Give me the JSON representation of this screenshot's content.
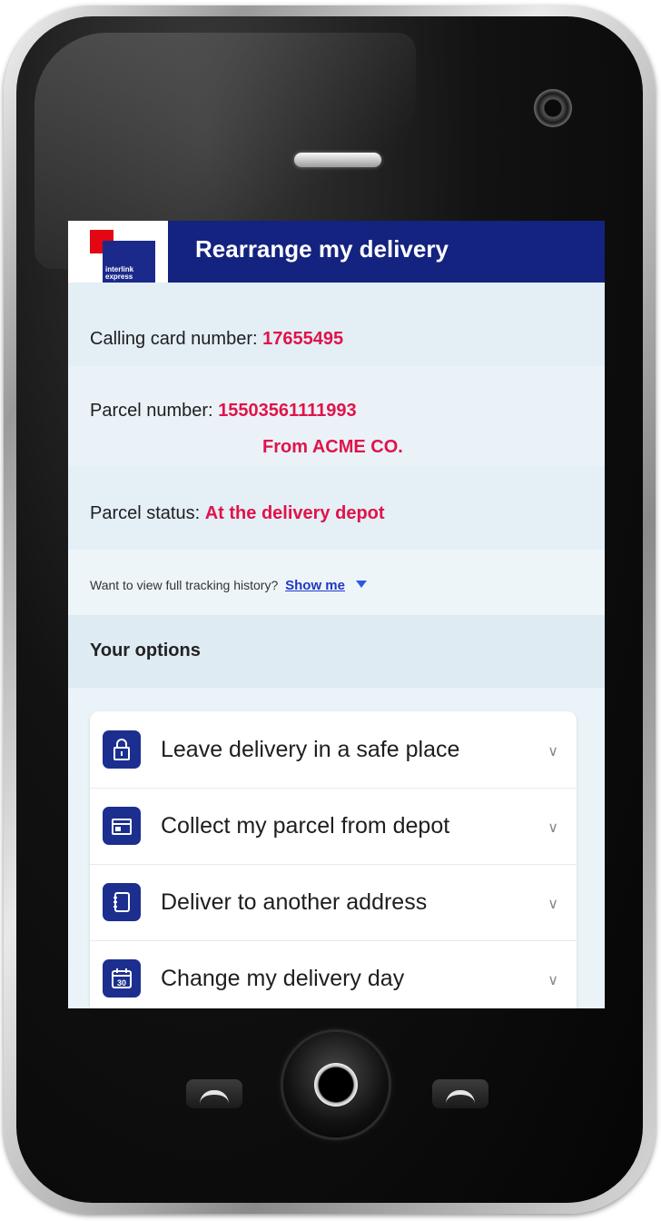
{
  "header": {
    "title": "Rearrange my delivery",
    "logo_text": "interlink express"
  },
  "details": {
    "calling_card_label": "Calling card number:",
    "calling_card_value": "17655495",
    "parcel_label": "Parcel number:",
    "parcel_value": "15503561111993",
    "parcel_from": "From ACME CO.",
    "status_label": "Parcel status:",
    "status_value": "At the delivery depot"
  },
  "tracking": {
    "prompt": "Want to view full tracking history?",
    "link": "Show me"
  },
  "options": {
    "title": "Your options",
    "items": [
      {
        "label": "Leave delivery in a safe place",
        "icon": "safe-place-icon"
      },
      {
        "label": "Collect my parcel from depot",
        "icon": "depot-icon"
      },
      {
        "label": "Deliver to another address",
        "icon": "address-book-icon"
      },
      {
        "label": "Change my delivery day",
        "icon": "calendar-icon",
        "icon_text": "30"
      }
    ]
  },
  "colors": {
    "brand_blue": "#14237f",
    "accent_red": "#e0134a",
    "link_blue": "#1d39c4"
  }
}
